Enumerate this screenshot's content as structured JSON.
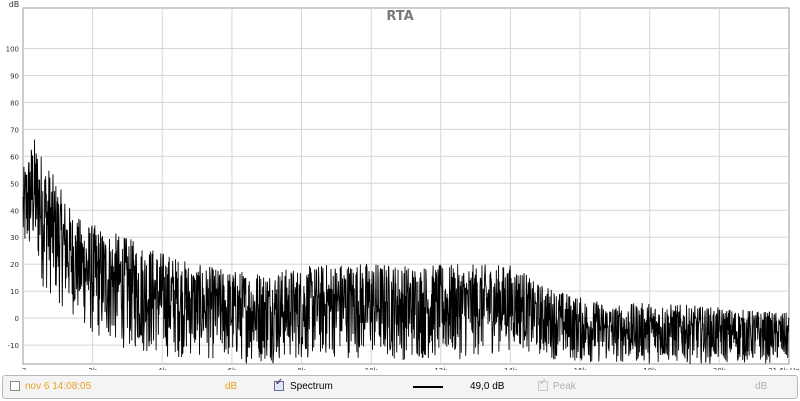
{
  "chart_data": {
    "type": "line",
    "title": "RTA",
    "ylabel": "dB",
    "xlabel": "Hz",
    "ylim": [
      -17,
      115
    ],
    "xlim": [
      2,
      21.6
    ],
    "y_ticks": [
      100,
      90,
      80,
      70,
      60,
      50,
      40,
      30,
      20,
      10,
      0,
      -10
    ],
    "x_ticks": [
      {
        "value": 2,
        "label": "2"
      },
      {
        "value": 4,
        "label": "2k"
      },
      {
        "value": 6,
        "label": "4k"
      },
      {
        "value": 8,
        "label": "6k"
      },
      {
        "value": 10,
        "label": "8k"
      },
      {
        "value": 12,
        "label": "10k"
      },
      {
        "value": 14,
        "label": "12k"
      },
      {
        "value": 16,
        "label": "14k"
      },
      {
        "value": 18,
        "label": "16k"
      },
      {
        "value": 20,
        "label": "18k"
      },
      {
        "value": 22,
        "label": "20k"
      },
      {
        "value": 24,
        "label": "21,6k Hz"
      }
    ],
    "grid": true,
    "series": [
      {
        "name": "Spectrum",
        "color": "#000000",
        "envelope": [
          {
            "x": 0.0,
            "top": 55,
            "bottom": 20
          },
          {
            "x": 0.3,
            "top": 68,
            "bottom": 22
          },
          {
            "x": 0.6,
            "top": 60,
            "bottom": 10
          },
          {
            "x": 1.0,
            "top": 50,
            "bottom": 5
          },
          {
            "x": 1.5,
            "top": 38,
            "bottom": 0
          },
          {
            "x": 2.0,
            "top": 35,
            "bottom": -8
          },
          {
            "x": 3.0,
            "top": 30,
            "bottom": -12
          },
          {
            "x": 4.0,
            "top": 25,
            "bottom": -15
          },
          {
            "x": 5.0,
            "top": 20,
            "bottom": -15
          },
          {
            "x": 6.0,
            "top": 18,
            "bottom": -17
          },
          {
            "x": 7.0,
            "top": 18,
            "bottom": -17
          },
          {
            "x": 8.0,
            "top": 19,
            "bottom": -16
          },
          {
            "x": 9.0,
            "top": 21,
            "bottom": -15
          },
          {
            "x": 10.0,
            "top": 21,
            "bottom": -15
          },
          {
            "x": 11.0,
            "top": 20,
            "bottom": -16
          },
          {
            "x": 12.0,
            "top": 20,
            "bottom": -16
          },
          {
            "x": 13.0,
            "top": 20,
            "bottom": -15
          },
          {
            "x": 14.0,
            "top": 20,
            "bottom": -12
          },
          {
            "x": 14.4,
            "top": 18,
            "bottom": -12
          },
          {
            "x": 14.6,
            "top": 14,
            "bottom": -14
          },
          {
            "x": 15.5,
            "top": 10,
            "bottom": -16
          },
          {
            "x": 16.0,
            "top": 8,
            "bottom": -17
          },
          {
            "x": 17.0,
            "top": 5,
            "bottom": -17
          },
          {
            "x": 18.0,
            "top": 6,
            "bottom": -17
          },
          {
            "x": 19.0,
            "top": 5,
            "bottom": -17
          },
          {
            "x": 20.0,
            "top": 4,
            "bottom": -17
          },
          {
            "x": 21.0,
            "top": 3,
            "bottom": -17
          },
          {
            "x": 22.0,
            "top": 2,
            "bottom": -17
          }
        ]
      }
    ]
  },
  "footer": {
    "timestamp": "nov 6 14:08:05",
    "timestamp_checked": false,
    "unit_left": "dB",
    "spectrum_label": "Spectrum",
    "spectrum_checked": true,
    "line_color": "#000000",
    "level": "49,0 dB",
    "peak_label": "Peak",
    "peak_checked": true,
    "unit_right": "dB",
    "accent": "#e8a020",
    "muted": "#b0b0b0"
  }
}
